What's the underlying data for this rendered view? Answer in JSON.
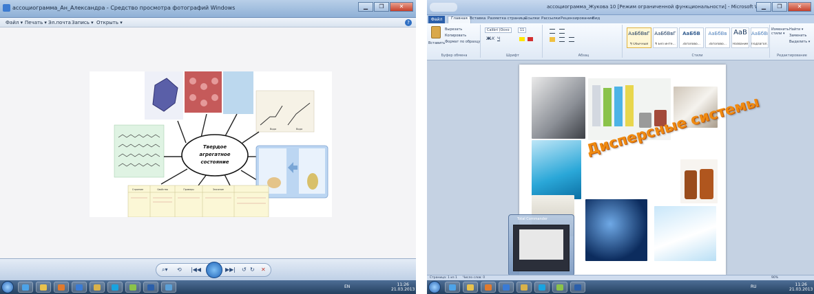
{
  "left_window": {
    "title": "ассоциограмма_Ан_Александра - Средство просмотра фотографий Windows",
    "menu": [
      {
        "label": "Файл ▾"
      },
      {
        "label": "Печать ▾"
      },
      {
        "label": "Эл.почта"
      },
      {
        "label": "Запись ▾"
      },
      {
        "label": "Открыть ▾"
      }
    ],
    "help": "?",
    "window_buttons": [
      "▁",
      "❐",
      "✕"
    ],
    "mindmap": {
      "center": "Твердое агрегатное состояние",
      "center_lines": [
        "Твердое",
        "агрегатное",
        "состояние"
      ],
      "graph_labels": [
        "Вода",
        "Вода"
      ],
      "card_labels": [
        "Кристалл",
        "Твердое состояние веществ"
      ],
      "table_headers": [
        "Строение",
        "Свойства",
        "Примеры",
        "Значение"
      ]
    },
    "controls": [
      "⌕▾",
      "⟲",
      "|◀◀",
      "▶▶|",
      "↺",
      "↻",
      "✕"
    ]
  },
  "left_taskbar": {
    "clock_time": "11:26",
    "clock_date": "21.03.2013",
    "tray_lang": "EN"
  },
  "right_window": {
    "title": "ассоциограмма_Жукова 10 [Режим ограниченной функциональности] - Microsoft Word",
    "file_tab": "Файл",
    "tabs": [
      "Главная",
      "Вставка",
      "Разметка страницы",
      "Ссылки",
      "Рассылки",
      "Рецензирование",
      "Вид"
    ],
    "ribbon": {
      "clipboard": {
        "paste": "Вставить",
        "cut": "Вырезать",
        "copy": "Копировать",
        "format": "Формат по образцу",
        "label": "Буфер обмена"
      },
      "font": {
        "name": "Calibri (Осно",
        "size": "11",
        "label": "Шрифт"
      },
      "paragraph_label": "Абзац",
      "styles": [
        {
          "sample": "АаБбВвГ",
          "name": "¶ Обычный"
        },
        {
          "sample": "АаБбВвГ",
          "name": "¶ Без инте..."
        },
        {
          "sample": "АаБбВ",
          "name": "Заголово..."
        },
        {
          "sample": "АаБбВв",
          "name": "Заголово..."
        },
        {
          "sample": "АаВ",
          "name": "Название"
        },
        {
          "sample": "АаБбВв",
          "name": "Подзагол..."
        }
      ],
      "styles_label": "Стили",
      "change_styles": "Изменить стили ▾",
      "editing": {
        "find": "Найти ▾",
        "replace": "Заменить",
        "select": "Выделить ▾",
        "label": "Редактирование"
      }
    },
    "wordart": "Дисперсные системы",
    "status": {
      "page": "Страница: 1 из 1",
      "words": "Число слов: 0",
      "zoom": "90%"
    },
    "thumbnail_title": "Total Commander"
  },
  "right_taskbar": {
    "clock_time": "11:26",
    "clock_date": "21.03.2013",
    "tray_lang": "RU"
  }
}
